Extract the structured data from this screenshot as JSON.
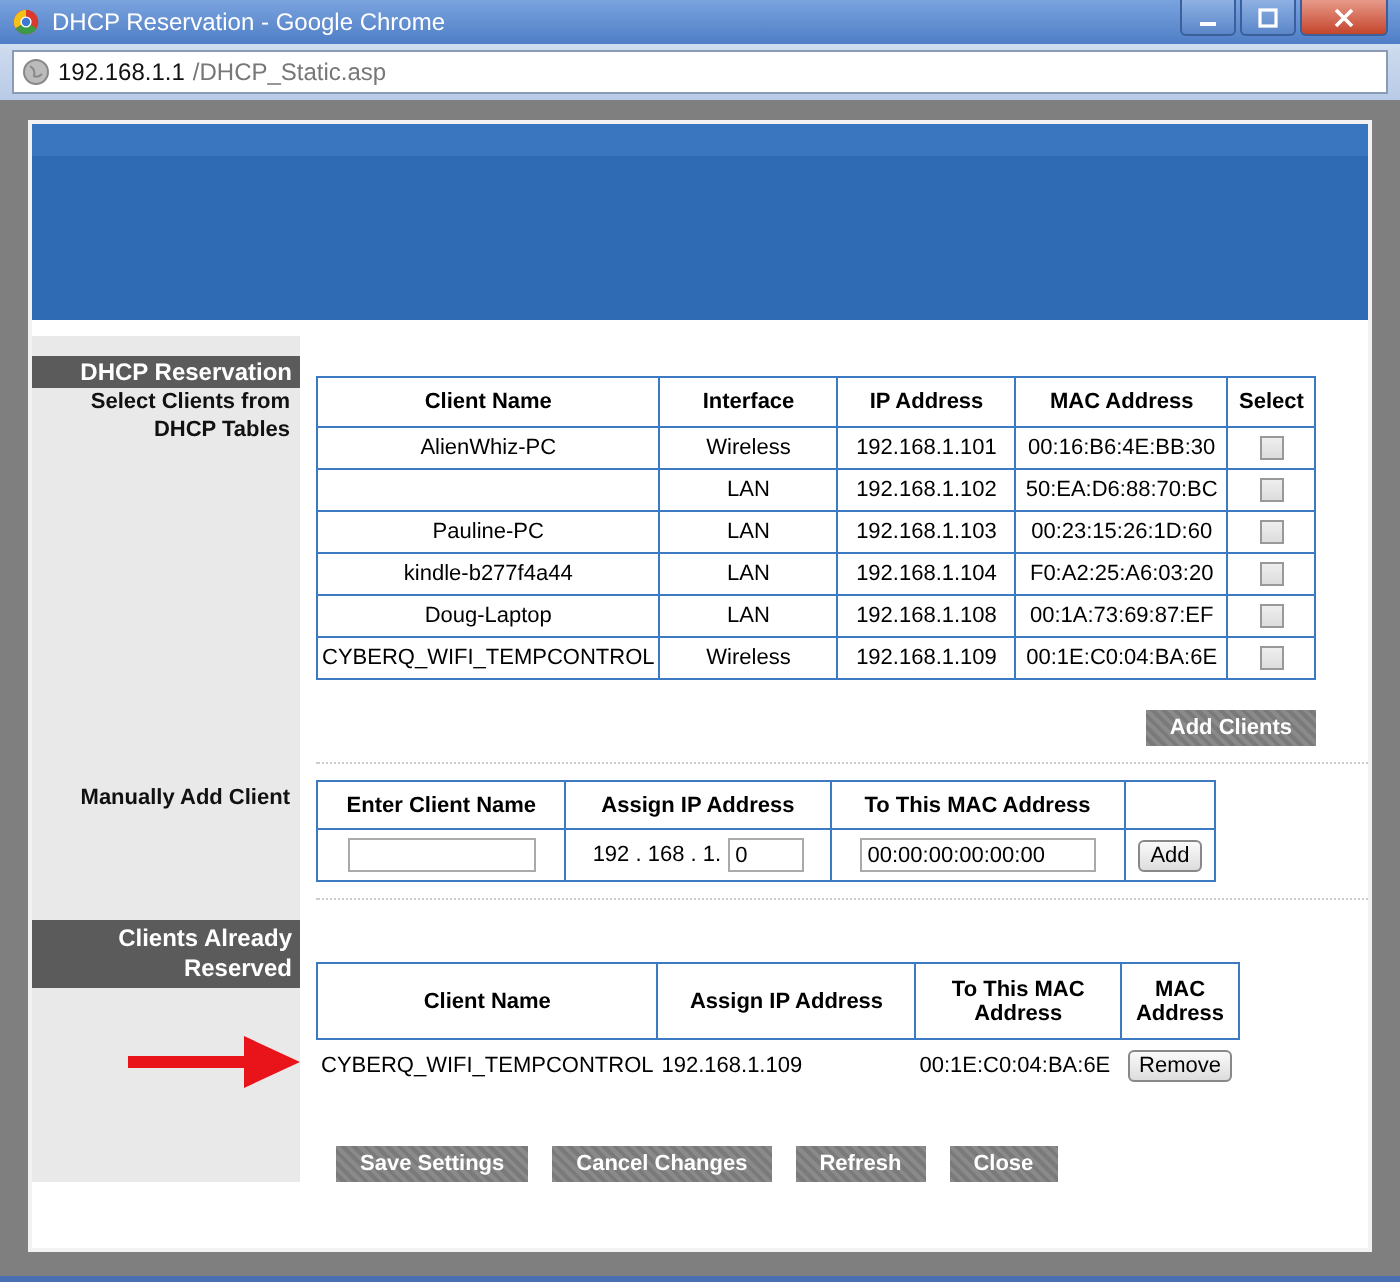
{
  "window": {
    "title": "DHCP Reservation - Google Chrome"
  },
  "address_bar": {
    "host": "192.168.1.1",
    "path": "/DHCP_Static.asp"
  },
  "dhcp_reservation": {
    "heading": "DHCP Reservation",
    "label": "Select Clients from DHCP Tables",
    "columns": [
      "Client Name",
      "Interface",
      "IP Address",
      "MAC Address",
      "Select"
    ],
    "rows": [
      {
        "client_name": "AlienWhiz-PC",
        "interface": "Wireless",
        "ip": "192.168.1.101",
        "mac": "00:16:B6:4E:BB:30",
        "selected": false
      },
      {
        "interface": "LAN",
        "ip": "192.168.1.102",
        "mac": "50:EA:D6:88:70:BC",
        "selected": false
      },
      {
        "client_name": "Pauline-PC",
        "interface": "LAN",
        "ip": "192.168.1.103",
        "mac": "00:23:15:26:1D:60",
        "selected": false
      },
      {
        "client_name": "kindle-b277f4a44",
        "interface": "LAN",
        "ip": "192.168.1.104",
        "mac": "F0:A2:25:A6:03:20",
        "selected": false
      },
      {
        "client_name": "Doug-Laptop",
        "interface": "LAN",
        "ip": "192.168.1.108",
        "mac": "00:1A:73:69:87:EF",
        "selected": false
      },
      {
        "client_name": "CYBERQ_WIFI_TEMPCONTROL",
        "interface": "Wireless",
        "ip": "192.168.1.109",
        "mac": "00:1E:C0:04:BA:6E",
        "selected": false
      }
    ],
    "button": "Add Clients"
  },
  "manual_add": {
    "label": "Manually Add Client",
    "columns": [
      "Enter Client Name",
      "Assign IP Address",
      "To This MAC Address"
    ],
    "ip_prefix": "192 . 168 . 1.",
    "ip_value": "0",
    "mac_value": "00:00:00:00:00:00",
    "button": "Add"
  },
  "reserved": {
    "heading": "Clients Already Reserved",
    "columns": [
      "Client Name",
      "Assign IP Address",
      "To This MAC Address",
      "MAC Address"
    ],
    "rows": [
      {
        "client_name": "CYBERQ_WIFI_TEMPCONTROL",
        "ip": "192.168.1.109",
        "mac": "00:1E:C0:04:BA:6E",
        "button": "Remove"
      }
    ]
  },
  "buttons": [
    "Save Settings",
    "Cancel Changes",
    "Refresh",
    "Close"
  ]
}
